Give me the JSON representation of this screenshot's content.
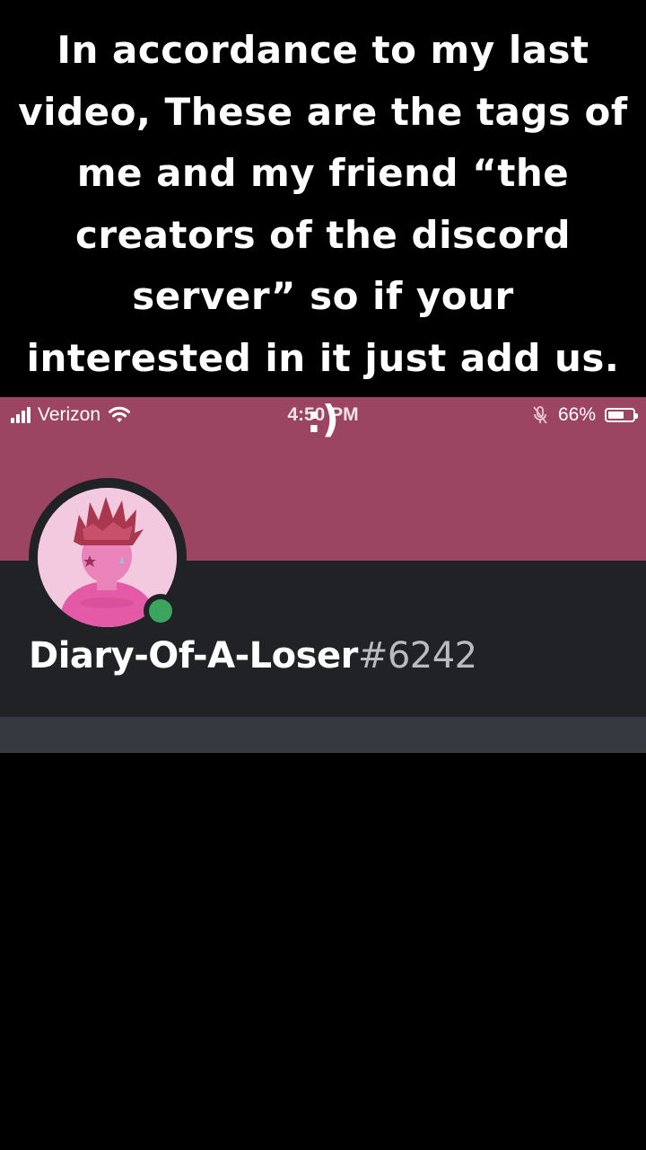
{
  "caption": {
    "text": "In accordance to my last video, These are the tags of me and my friend “the creators of the discord server” so if your interested in it just add us. :)"
  },
  "status_bar": {
    "carrier": "Verizon",
    "time": "4:50 PM",
    "battery_percent": "66%",
    "battery_level": 0.66
  },
  "profile": {
    "username": "Diary-Of-A-Loser",
    "discriminator": "#6242",
    "presence": "online",
    "banner_color": "#9c4562",
    "presence_color": "#3ba55d"
  }
}
